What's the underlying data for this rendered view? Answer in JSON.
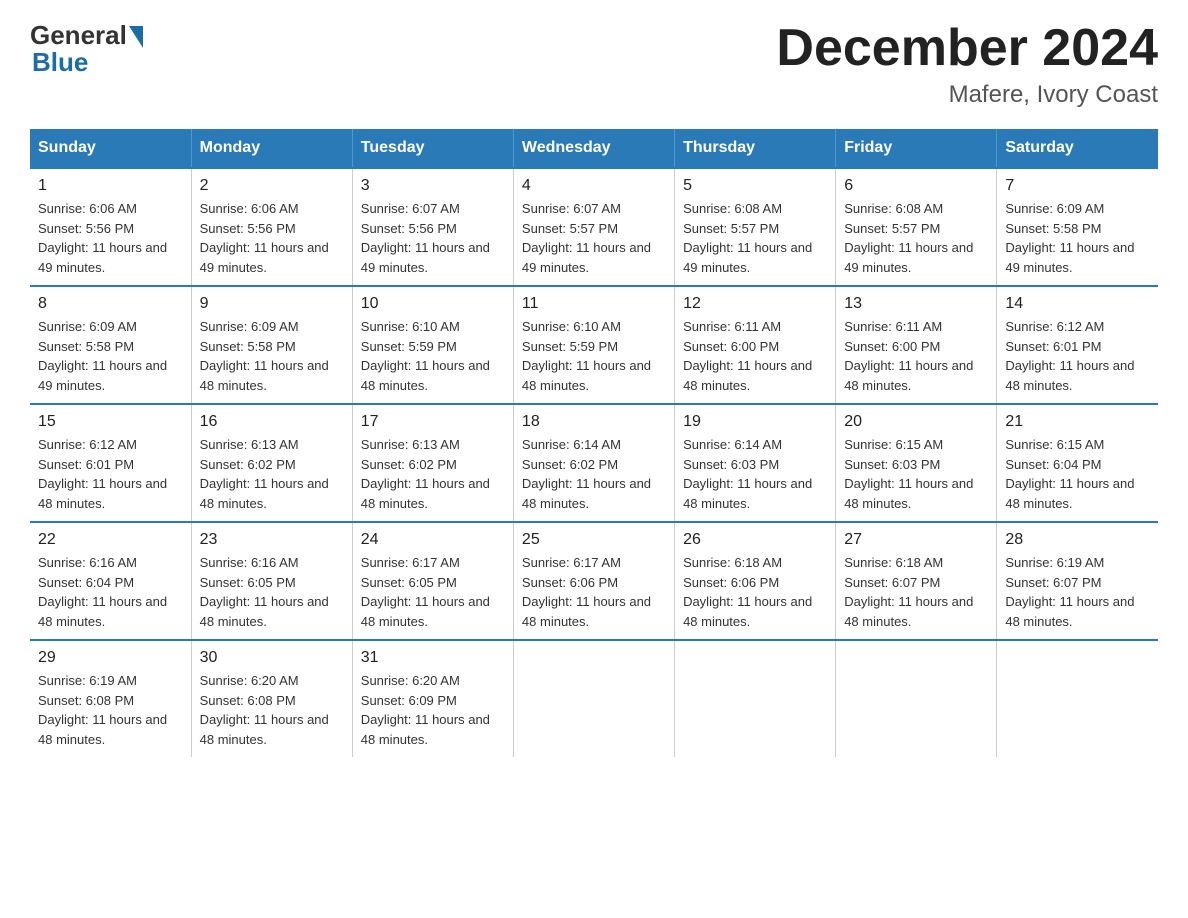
{
  "logo": {
    "general": "General",
    "blue": "Blue"
  },
  "title": "December 2024",
  "subtitle": "Mafere, Ivory Coast",
  "days_of_week": [
    "Sunday",
    "Monday",
    "Tuesday",
    "Wednesday",
    "Thursday",
    "Friday",
    "Saturday"
  ],
  "weeks": [
    [
      {
        "day": "1",
        "sunrise": "6:06 AM",
        "sunset": "5:56 PM",
        "daylight": "11 hours and 49 minutes."
      },
      {
        "day": "2",
        "sunrise": "6:06 AM",
        "sunset": "5:56 PM",
        "daylight": "11 hours and 49 minutes."
      },
      {
        "day": "3",
        "sunrise": "6:07 AM",
        "sunset": "5:56 PM",
        "daylight": "11 hours and 49 minutes."
      },
      {
        "day": "4",
        "sunrise": "6:07 AM",
        "sunset": "5:57 PM",
        "daylight": "11 hours and 49 minutes."
      },
      {
        "day": "5",
        "sunrise": "6:08 AM",
        "sunset": "5:57 PM",
        "daylight": "11 hours and 49 minutes."
      },
      {
        "day": "6",
        "sunrise": "6:08 AM",
        "sunset": "5:57 PM",
        "daylight": "11 hours and 49 minutes."
      },
      {
        "day": "7",
        "sunrise": "6:09 AM",
        "sunset": "5:58 PM",
        "daylight": "11 hours and 49 minutes."
      }
    ],
    [
      {
        "day": "8",
        "sunrise": "6:09 AM",
        "sunset": "5:58 PM",
        "daylight": "11 hours and 49 minutes."
      },
      {
        "day": "9",
        "sunrise": "6:09 AM",
        "sunset": "5:58 PM",
        "daylight": "11 hours and 48 minutes."
      },
      {
        "day": "10",
        "sunrise": "6:10 AM",
        "sunset": "5:59 PM",
        "daylight": "11 hours and 48 minutes."
      },
      {
        "day": "11",
        "sunrise": "6:10 AM",
        "sunset": "5:59 PM",
        "daylight": "11 hours and 48 minutes."
      },
      {
        "day": "12",
        "sunrise": "6:11 AM",
        "sunset": "6:00 PM",
        "daylight": "11 hours and 48 minutes."
      },
      {
        "day": "13",
        "sunrise": "6:11 AM",
        "sunset": "6:00 PM",
        "daylight": "11 hours and 48 minutes."
      },
      {
        "day": "14",
        "sunrise": "6:12 AM",
        "sunset": "6:01 PM",
        "daylight": "11 hours and 48 minutes."
      }
    ],
    [
      {
        "day": "15",
        "sunrise": "6:12 AM",
        "sunset": "6:01 PM",
        "daylight": "11 hours and 48 minutes."
      },
      {
        "day": "16",
        "sunrise": "6:13 AM",
        "sunset": "6:02 PM",
        "daylight": "11 hours and 48 minutes."
      },
      {
        "day": "17",
        "sunrise": "6:13 AM",
        "sunset": "6:02 PM",
        "daylight": "11 hours and 48 minutes."
      },
      {
        "day": "18",
        "sunrise": "6:14 AM",
        "sunset": "6:02 PM",
        "daylight": "11 hours and 48 minutes."
      },
      {
        "day": "19",
        "sunrise": "6:14 AM",
        "sunset": "6:03 PM",
        "daylight": "11 hours and 48 minutes."
      },
      {
        "day": "20",
        "sunrise": "6:15 AM",
        "sunset": "6:03 PM",
        "daylight": "11 hours and 48 minutes."
      },
      {
        "day": "21",
        "sunrise": "6:15 AM",
        "sunset": "6:04 PM",
        "daylight": "11 hours and 48 minutes."
      }
    ],
    [
      {
        "day": "22",
        "sunrise": "6:16 AM",
        "sunset": "6:04 PM",
        "daylight": "11 hours and 48 minutes."
      },
      {
        "day": "23",
        "sunrise": "6:16 AM",
        "sunset": "6:05 PM",
        "daylight": "11 hours and 48 minutes."
      },
      {
        "day": "24",
        "sunrise": "6:17 AM",
        "sunset": "6:05 PM",
        "daylight": "11 hours and 48 minutes."
      },
      {
        "day": "25",
        "sunrise": "6:17 AM",
        "sunset": "6:06 PM",
        "daylight": "11 hours and 48 minutes."
      },
      {
        "day": "26",
        "sunrise": "6:18 AM",
        "sunset": "6:06 PM",
        "daylight": "11 hours and 48 minutes."
      },
      {
        "day": "27",
        "sunrise": "6:18 AM",
        "sunset": "6:07 PM",
        "daylight": "11 hours and 48 minutes."
      },
      {
        "day": "28",
        "sunrise": "6:19 AM",
        "sunset": "6:07 PM",
        "daylight": "11 hours and 48 minutes."
      }
    ],
    [
      {
        "day": "29",
        "sunrise": "6:19 AM",
        "sunset": "6:08 PM",
        "daylight": "11 hours and 48 minutes."
      },
      {
        "day": "30",
        "sunrise": "6:20 AM",
        "sunset": "6:08 PM",
        "daylight": "11 hours and 48 minutes."
      },
      {
        "day": "31",
        "sunrise": "6:20 AM",
        "sunset": "6:09 PM",
        "daylight": "11 hours and 48 minutes."
      },
      null,
      null,
      null,
      null
    ]
  ]
}
